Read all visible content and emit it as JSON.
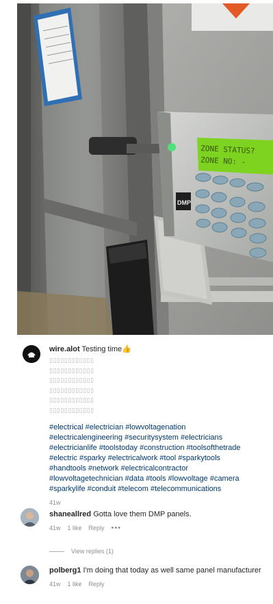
{
  "post": {
    "username": "wire.alot",
    "caption": "Testing time",
    "caption_emoji": "👍",
    "placeholder_lines": [
      "▯▯▯▯▯▯▯▯▯▯▯▯",
      "▯▯▯▯▯▯▯▯▯▯▯▯",
      "▯▯▯▯▯▯▯▯▯▯▯▯",
      "▯▯▯▯▯▯▯▯▯▯▯▯",
      "▯▯▯▯▯▯▯▯▯▯▯▯",
      "▯▯▯▯▯▯▯▯▯▯▯▯"
    ],
    "hashtags": [
      "#electrical #electrician #lowvoltagenation",
      "#electricalengineering #securitysystem #electricians",
      "#electricianlife #toolstoday #construction #toolsofthetrade",
      "#electric #sparky #electricalwork #tool #sparkytools",
      "#handtools #network #electricalcontractor",
      "#lowvoltagetechnician #data #tools #lowvoltage #camera",
      "#sparkylife #conduit #telecom #telecommunications"
    ],
    "time": "41w"
  },
  "keypad": {
    "lcd_line1": "ZONE STATUS?",
    "lcd_line2": "ZONE NO: -",
    "brand": "DMP"
  },
  "comments": [
    {
      "username": "shaneallred",
      "text": "Gotta love them DMP panels.",
      "time": "41w",
      "likes": "1 like",
      "reply": "Reply",
      "more": "•••"
    },
    {
      "username": "polberg1",
      "text": "I'm doing that today as well same panel manufacturer",
      "time": "41w",
      "likes": "1 like",
      "reply": "Reply"
    }
  ],
  "view_replies": "View replies (1)",
  "colors": {
    "hashtag": "#00376b",
    "muted": "#8e8e8e",
    "lcd": "#7ed321"
  }
}
